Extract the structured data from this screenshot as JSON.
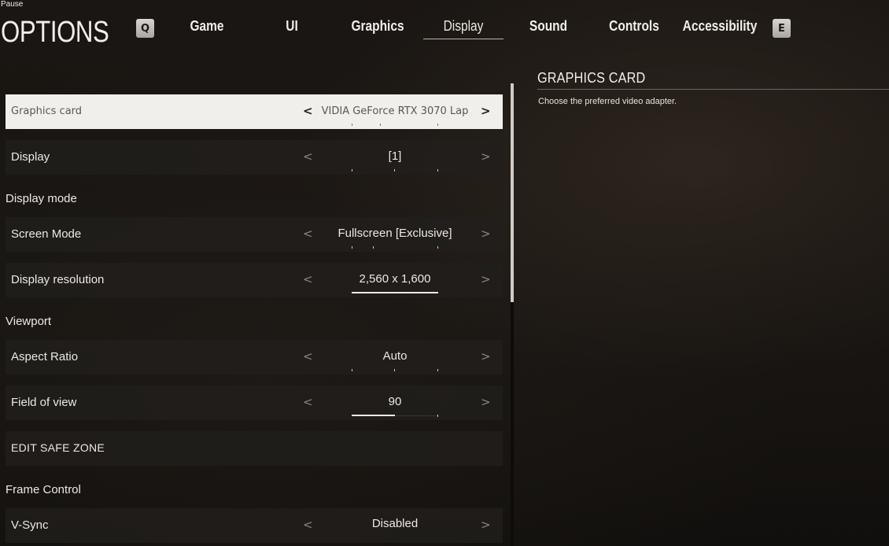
{
  "header": {
    "pause_label": "Pause",
    "title": "OPTIONS",
    "prev_key": "Q",
    "next_key": "E"
  },
  "tabs": [
    {
      "label": "Game",
      "active": false
    },
    {
      "label": "UI",
      "active": false
    },
    {
      "label": "Graphics",
      "active": false
    },
    {
      "label": "Display",
      "active": true
    },
    {
      "label": "Sound",
      "active": false
    },
    {
      "label": "Controls",
      "active": false
    },
    {
      "label": "Accessibility",
      "active": false
    }
  ],
  "settings": {
    "graphics_card": {
      "label": "Graphics card",
      "value": "VIDIA GeForce RTX 3070 Lap",
      "selected": true
    },
    "display": {
      "label": "Display",
      "value": "[1]"
    },
    "section_display_mode": "Display mode",
    "screen_mode": {
      "label": "Screen Mode",
      "value": "Fullscreen [Exclusive]"
    },
    "display_resolution": {
      "label": "Display resolution",
      "value": "2,560 x 1,600",
      "progress": 1.0
    },
    "section_viewport": "Viewport",
    "aspect_ratio": {
      "label": "Aspect Ratio",
      "value": "Auto"
    },
    "field_of_view": {
      "label": "Field of view",
      "value": "90",
      "progress": 0.5
    },
    "edit_safe_zone": {
      "label": "EDIT SAFE ZONE"
    },
    "section_frame_control": "Frame Control",
    "vsync": {
      "label": "V-Sync",
      "value": "Disabled"
    }
  },
  "info_panel": {
    "title": "GRAPHICS CARD",
    "description": "Choose the preferred video adapter."
  },
  "icons": {
    "left_arrow": "chevron-left-icon",
    "right_arrow": "chevron-right-icon"
  }
}
